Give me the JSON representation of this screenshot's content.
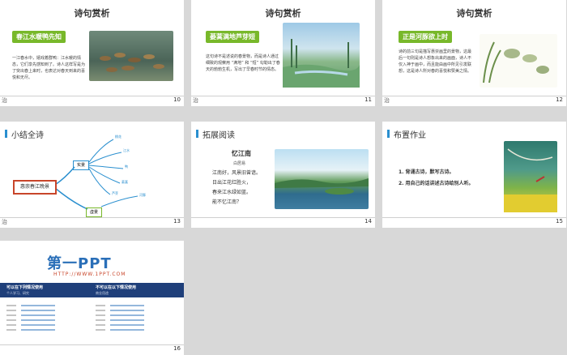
{
  "slides": [
    {
      "num": "10",
      "foot_left": "治",
      "title": "诗句赏析",
      "tag": "春江水暖鸭先知",
      "text": "一江春水中，嬉戏着群鸭：江水暖的情态，它们享先感知到了。诗人这样写是为了突出春上来时，也表达对春天到来的喜悦和无尽。"
    },
    {
      "num": "11",
      "foot_left": "治",
      "title": "诗句赏析",
      "tag": "蒌蒿满地芦芽短",
      "text": "这句诗不是述说的春景物，而是诗人通过细致的观察用 “满地” 和 “短” 勾勒出了春天的勃勃生机，写出了早春时节的情态。"
    },
    {
      "num": "12",
      "foot_left": "治",
      "title": "诗句赏析",
      "tag": "正是河豚欲上时",
      "text": "诗的前三句是描写惠崇画里的景物，这最后一句则是诗人想象出来的画面，诗人不仅入神于画中，而且能由画中所见引发联想，这是诗人所对春的喜悦和赞美之情。"
    },
    {
      "num": "13",
      "foot_left": "治",
      "title": "小结全诗",
      "center": "惠崇春江晚景",
      "branch1": "实景",
      "branch2": "虚景",
      "leaves": [
        "桃花",
        "江水",
        "鸭",
        "蒌蒿",
        "芦芽",
        "河豚"
      ]
    },
    {
      "num": "14",
      "foot_left": "治",
      "title": "拓展阅读",
      "poem_title": "忆江南",
      "poem_author": "白居易",
      "poem_lines": [
        "江南好，风景旧曾谙。",
        "日出江花红胜火，",
        "春来江水绿如蓝。",
        "能不忆江南？"
      ]
    },
    {
      "num": "15",
      "foot_left": "治",
      "title": "布置作业",
      "homework": [
        "1. 背诵古诗，默写古诗。",
        "2. 用自己的话讲述古诗给别人听。"
      ]
    },
    {
      "num": "16",
      "logo": "第一PPT",
      "url": "HTTP://WWW.1PPT.COM",
      "col1_title": "可以在下列情况使用",
      "col1_sub": "个人学习、研究",
      "col2_title": "不可以在以下情况使用",
      "col2_sub": "商业用途"
    }
  ]
}
